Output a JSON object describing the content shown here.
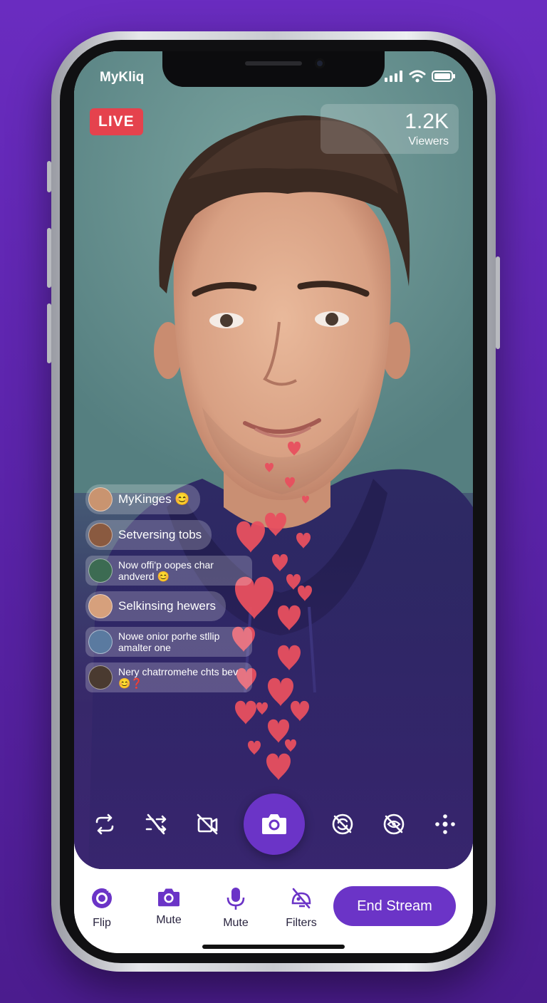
{
  "app": {
    "name": "MyKliq"
  },
  "stream": {
    "live_label": "LIVE",
    "viewer_count": "1.2K",
    "viewer_label": "Viewers"
  },
  "chat": {
    "messages": [
      {
        "text": "MyKinges 😊",
        "avatar_color": "#c99470"
      },
      {
        "text": "Setversing tobs",
        "avatar_color": "#8a5a40"
      },
      {
        "text": "Now offi'p oopes char andverd 😊",
        "avatar_color": "#3c6b52"
      },
      {
        "text": "Selkinsing hewers",
        "avatar_color": "#d6a07c"
      },
      {
        "text": "Nowe onior porhe stllip amalter one",
        "avatar_color": "#5a7aa0"
      },
      {
        "text": "Nery chatrromehe chts bev 😊❓",
        "avatar_color": "#4a3a30"
      }
    ]
  },
  "controls": {
    "icons": [
      "repeat-icon",
      "shuffle-off-icon",
      "video-off-icon",
      "camera-icon",
      "sync-off-icon",
      "eye-off-icon",
      "more-icon"
    ]
  },
  "bottom_bar": {
    "items": [
      {
        "label": "Flip",
        "icon": "flip-camera-icon"
      },
      {
        "label": "Mute",
        "icon": "camera-icon"
      },
      {
        "label": "Mute",
        "icon": "microphone-icon"
      },
      {
        "label": "Filters",
        "icon": "filters-icon"
      }
    ],
    "end_button": "End Stream"
  },
  "colors": {
    "accent": "#6b34c7",
    "live": "#e5424d",
    "heart": "#e8505f"
  }
}
